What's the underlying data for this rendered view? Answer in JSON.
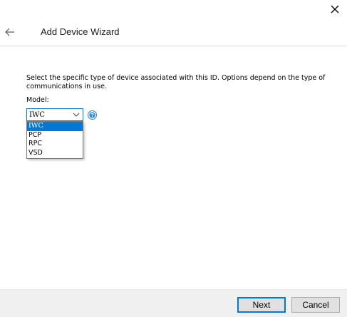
{
  "header": {
    "title": "Add Device Wizard"
  },
  "content": {
    "description": "Select the specific type of device associated with this ID. Options depend on the type of communications in use.",
    "model_label": "Model:",
    "model_select": {
      "value": "IWC",
      "options": [
        "IWC",
        "PCP",
        "RPC",
        "VSD"
      ]
    }
  },
  "footer": {
    "next_label": "Next",
    "cancel_label": "Cancel"
  },
  "icons": {
    "close": "close-icon",
    "back": "back-arrow-icon",
    "chevron": "chevron-down-icon",
    "help": "help-icon"
  },
  "colors": {
    "accent": "#0078d7",
    "footer_bg": "#f0f0f0"
  }
}
